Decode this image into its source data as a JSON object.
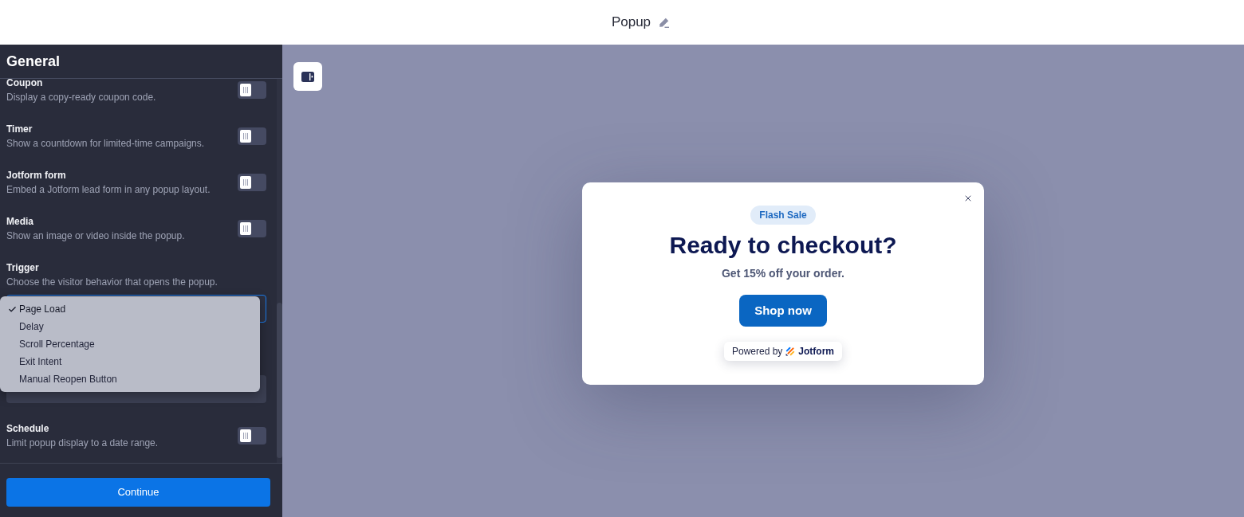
{
  "top_bar": {
    "title": "Popup"
  },
  "sidebar": {
    "title": "General",
    "settings": [
      {
        "kind": "toggle",
        "title": "Coupon",
        "description": "Display a copy-ready coupon code.",
        "on": false
      },
      {
        "kind": "toggle",
        "title": "Timer",
        "description": "Show a countdown for limited-time campaigns.",
        "on": false
      },
      {
        "kind": "toggle",
        "title": "Jotform form",
        "description": "Embed a Jotform lead form in any popup layout.",
        "on": false
      },
      {
        "kind": "toggle",
        "title": "Media",
        "description": "Show an image or video inside the popup.",
        "on": false
      },
      {
        "kind": "select",
        "title": "Trigger",
        "description": "Choose the visitor behavior that opens the popup.",
        "focused": true,
        "expanded": true,
        "options": [
          {
            "label": "Page Load",
            "selected": true
          },
          {
            "label": "Delay",
            "selected": false
          },
          {
            "label": "Scroll Percentage",
            "selected": false
          },
          {
            "label": "Exit Intent",
            "selected": false
          },
          {
            "label": "Manual Reopen Button",
            "selected": false
          }
        ]
      },
      {
        "kind": "select",
        "focused": false
      },
      {
        "kind": "toggle",
        "title": "Schedule",
        "description": "Limit popup display to a date range.",
        "on": false
      }
    ],
    "continue_button": "Continue"
  },
  "canvas": {
    "popup": {
      "badge": "Flash Sale",
      "title": "Ready to checkout?",
      "subtitle": "Get 15% off your order.",
      "button": "Shop now",
      "powered_by": {
        "label": "Powered by",
        "brand": "Jotform"
      }
    }
  }
}
